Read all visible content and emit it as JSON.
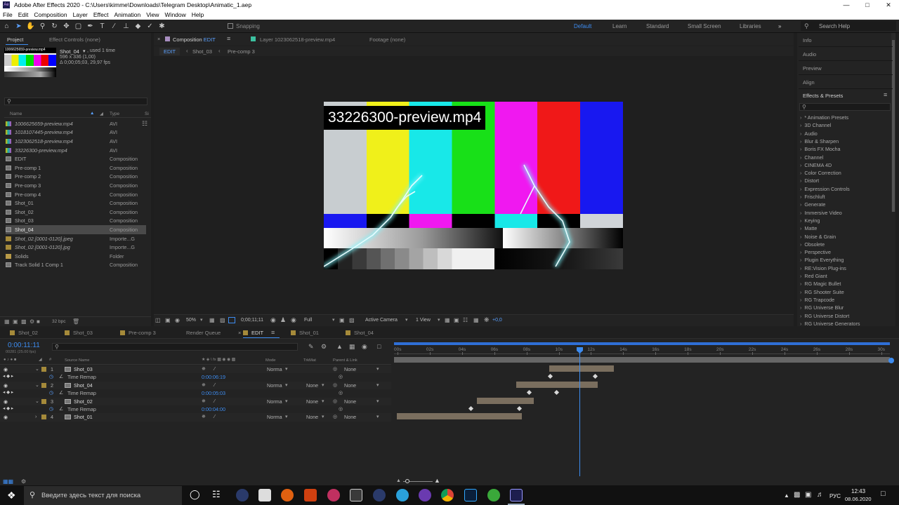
{
  "window": {
    "title": "Adobe After Effects 2020 - C:\\Users\\kimme\\Downloads\\Telegram Desktop\\Animatic_1.aep",
    "logo": "Ae"
  },
  "menu": [
    "File",
    "Edit",
    "Composition",
    "Layer",
    "Effect",
    "Animation",
    "View",
    "Window",
    "Help"
  ],
  "toolbar": {
    "snapping": "Snapping",
    "search_placeholder": "Search Help"
  },
  "workspaces": [
    "Default",
    "Learn",
    "Standard",
    "Small Screen",
    "Libraries"
  ],
  "project": {
    "tab_project": "Project",
    "tab_effect_controls": "Effect Controls (none)",
    "selected_name": "Shot_04",
    "selected_used": ", used 1 time",
    "selected_dims": "596 x 336 (1,00)",
    "selected_duration": "Δ 0;00;05;03, 29,97 fps",
    "thumb_label": "1006625659-preview.mp4",
    "col_name": "Name",
    "col_type": "Type",
    "col_size": "Si",
    "items": [
      {
        "name": "1006625659-preview.mp4",
        "type": "AVI",
        "kind": "avi"
      },
      {
        "name": "1018107445-preview.mp4",
        "type": "AVI",
        "kind": "avi"
      },
      {
        "name": "1023062518-preview.mp4",
        "type": "AVI",
        "kind": "avi"
      },
      {
        "name": "33226300-preview.mp4",
        "type": "AVI",
        "kind": "avi"
      },
      {
        "name": "EDIT",
        "type": "Composition",
        "kind": "comp"
      },
      {
        "name": "Pre-comp 1",
        "type": "Composition",
        "kind": "comp"
      },
      {
        "name": "Pre-comp 2",
        "type": "Composition",
        "kind": "comp"
      },
      {
        "name": "Pre-comp 3",
        "type": "Composition",
        "kind": "comp"
      },
      {
        "name": "Pre-comp 4",
        "type": "Composition",
        "kind": "comp"
      },
      {
        "name": "Shot_01",
        "type": "Composition",
        "kind": "comp"
      },
      {
        "name": "Shot_02",
        "type": "Composition",
        "kind": "comp"
      },
      {
        "name": "Shot_03",
        "type": "Composition",
        "kind": "comp"
      },
      {
        "name": "Shot_04",
        "type": "Composition",
        "kind": "comp",
        "selected": true
      },
      {
        "name": "Shot_02.[0001-0120].jpeg",
        "type": "Importe...G",
        "kind": "img"
      },
      {
        "name": "Shot_02.[0001-0120].jpg",
        "type": "Importe...G",
        "kind": "img"
      },
      {
        "name": "Solids",
        "type": "Folder",
        "kind": "fold"
      },
      {
        "name": "Track Solid 1 Comp 1",
        "type": "Composition",
        "kind": "comp"
      }
    ],
    "bpc": "32 bpc"
  },
  "viewer": {
    "tab_comp": "Composition",
    "tab_comp_name": "EDIT",
    "tab_layer": "Layer 1023062518-preview.mp4",
    "tab_footage": "Footage (none)",
    "crumbs": [
      "EDIT",
      "Shot_03",
      "Pre-comp 3"
    ],
    "overlay_text": "33226300-preview.mp4",
    "zoom": "50%",
    "timecode": "0;00;11;11",
    "resolution": "Full",
    "camera": "Active Camera",
    "views": "1 View",
    "exposure": "+0,0"
  },
  "right": {
    "panels": [
      "Info",
      "Audio",
      "Preview",
      "Align"
    ],
    "effects_title": "Effects & Presets",
    "categories": [
      "* Animation Presets",
      "3D Channel",
      "Audio",
      "Blur & Sharpen",
      "Boris FX Mocha",
      "Channel",
      "CINEMA 4D",
      "Color Correction",
      "Distort",
      "Expression Controls",
      "Frischluft",
      "Generate",
      "Immersive Video",
      "Keying",
      "Matte",
      "Noise & Grain",
      "Obsolete",
      "Perspective",
      "Plugin Everything",
      "RE:Vision Plug-ins",
      "Red Giant",
      "RG Magic Bullet",
      "RG Shooter Suite",
      "RG Trapcode",
      "RG Universe Blur",
      "RG Universe Distort",
      "RG Universe Generators"
    ]
  },
  "timeline": {
    "tabs": [
      "Shot_02",
      "Shot_03",
      "Pre-comp 3",
      "Render Queue",
      "EDIT",
      "Shot_01",
      "Shot_04"
    ],
    "active_tab": "EDIT",
    "timecode": "0:00:11:11",
    "timecode_sub": "00281 (25.00 fps)",
    "col_source": "Source Name",
    "col_mode": "Mode",
    "col_trkmat": "TrkMat",
    "col_parent": "Parent & Link",
    "ruler": [
      "00s",
      "02s",
      "04s",
      "06s",
      "08s",
      "10s",
      "12s",
      "14s",
      "16s",
      "18s",
      "20s",
      "22s",
      "24s",
      "26s",
      "28s",
      "30s"
    ],
    "rows": [
      {
        "kind": "layer",
        "num": "1",
        "name": "Shot_03",
        "mode": "Norma",
        "trk": "",
        "parent": "None"
      },
      {
        "kind": "remap",
        "label": "Time Remap",
        "value": "0:00:06:19"
      },
      {
        "kind": "layer",
        "num": "2",
        "name": "Shot_04",
        "mode": "Norma",
        "trk": "None",
        "parent": "None"
      },
      {
        "kind": "remap",
        "label": "Time Remap",
        "value": "0:00:05:03"
      },
      {
        "kind": "layer",
        "num": "3",
        "name": "Shot_02",
        "mode": "Norma",
        "trk": "None",
        "parent": "None"
      },
      {
        "kind": "remap",
        "label": "Time Remap",
        "value": "0:00:04:00"
      },
      {
        "kind": "layer",
        "num": "4",
        "name": "Shot_01",
        "mode": "Norma",
        "trk": "None",
        "parent": "None"
      }
    ]
  },
  "taskbar": {
    "search_placeholder": "Введите здесь текст для поиска",
    "lang": "РУС",
    "time": "12:43",
    "date": "08.06.2020"
  },
  "colors": {
    "accent": "#3d8cf0",
    "panel": "#232323",
    "bg": "#1e1e1e",
    "bar": "#7a6e5e"
  }
}
